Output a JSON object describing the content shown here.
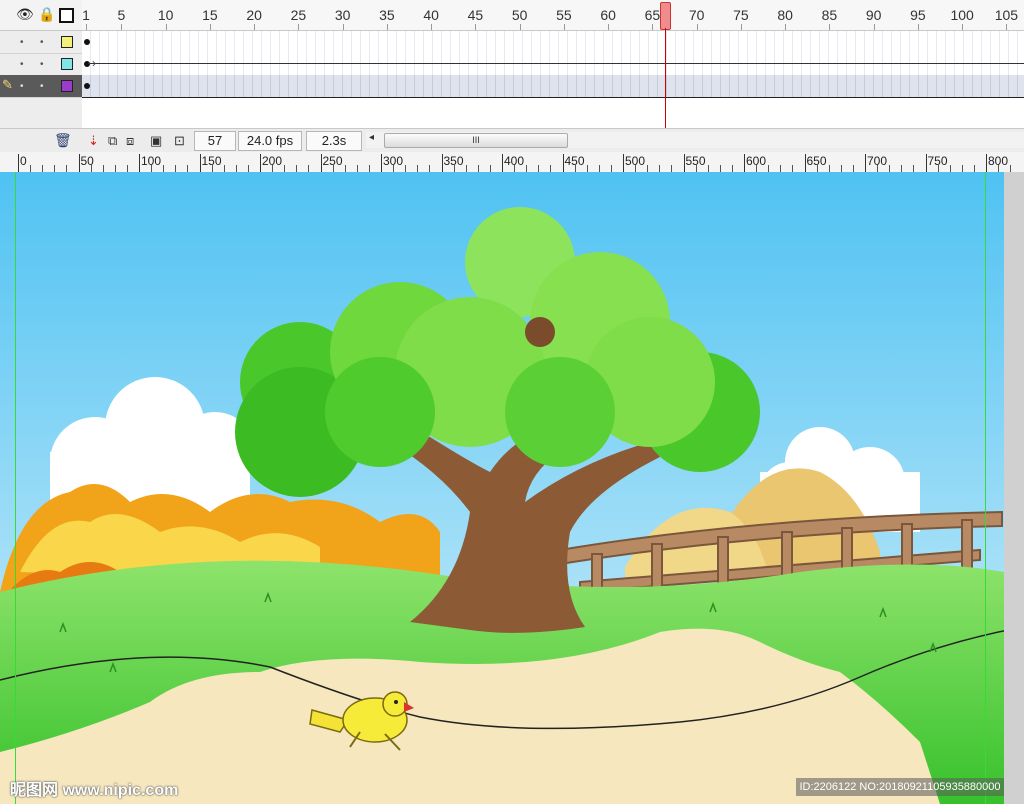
{
  "timeline": {
    "frame_numbers": [
      "1",
      "5",
      "10",
      "15",
      "20",
      "25",
      "30",
      "35",
      "40",
      "45",
      "50",
      "55",
      "60",
      "65",
      "70",
      "75",
      "80",
      "85",
      "90",
      "95",
      "100",
      "105"
    ],
    "current_frame": "57",
    "fps": "24.0 fps",
    "elapsed": "2.3s",
    "scroll_thumb_label": "III",
    "layers": [
      {
        "color": "#f5f07a",
        "tween": false,
        "selected": false
      },
      {
        "color": "#7fe7e7",
        "tween": true,
        "selected": false
      },
      {
        "color": "#9b3ccf",
        "tween": false,
        "selected": true
      }
    ],
    "icons": {
      "eye": "eye-icon",
      "lock": "lock-icon",
      "outline": "outline-icon",
      "trash": "trash-icon",
      "onion": "onion-skin-icon",
      "edit_multiple": "edit-multiple-frames-icon"
    }
  },
  "stage_ruler": {
    "labels": [
      "0",
      "50",
      "100",
      "150",
      "200",
      "250",
      "300",
      "350",
      "400",
      "450",
      "500",
      "550",
      "600",
      "650",
      "700",
      "750",
      "800"
    ]
  },
  "watermark": {
    "left": "昵图网 www.nipic.com",
    "right": "ID:2206122 NO:20180921105935880000"
  },
  "colors": {
    "sky_top": "#5ecbf5",
    "sky_bottom": "#d6f1fc",
    "grass": "#4ccf3a",
    "path": "#f4e4b6",
    "tree_leaf": "#7ee04a",
    "trunk": "#8c5b36",
    "bird": "#f4ea36"
  }
}
